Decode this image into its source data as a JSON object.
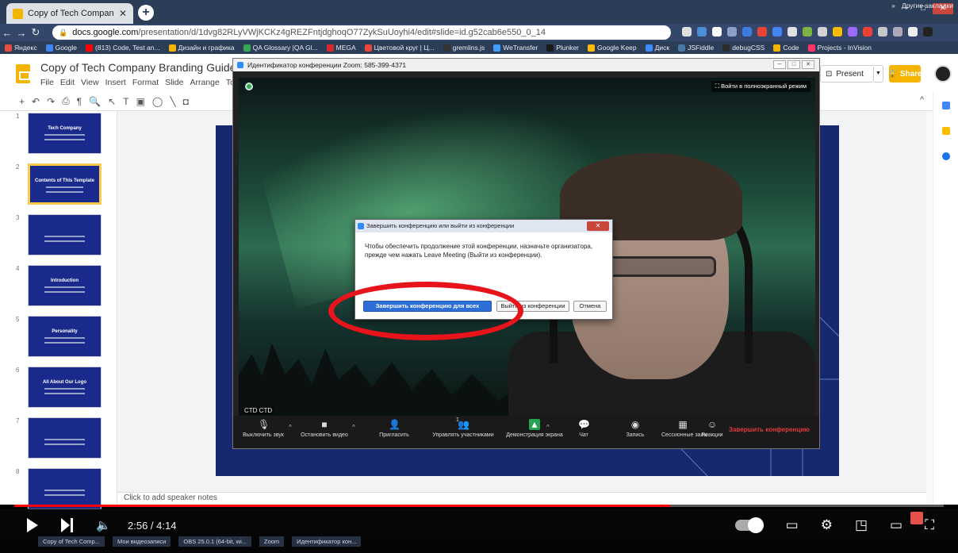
{
  "browser": {
    "tab_title": "Copy of Tech Company Branding",
    "url_host": "docs.google.com",
    "url_path": "/presentation/d/1dvg82RLyVWjKCKz4gREZFntjdghoqO77ZykSuUoyhi4/edit#slide=id.g52cab6e550_0_14",
    "bookmarks": [
      {
        "label": "Яндекс",
        "color": "#e74c3c"
      },
      {
        "label": "Google",
        "color": "#4285f4"
      },
      {
        "label": "(813) Code, Test an...",
        "color": "#ff0000"
      },
      {
        "label": "Дизайн и графика",
        "color": "#f4b400"
      },
      {
        "label": "QA Glossary |QA Gl...",
        "color": "#34a853"
      },
      {
        "label": "MEGA",
        "color": "#d9272e"
      },
      {
        "label": "Цветовой круг | Ц...",
        "color": "#e8453c"
      },
      {
        "label": "gremlins.js",
        "color": "#333333"
      },
      {
        "label": "WeTransfer",
        "color": "#409fff"
      },
      {
        "label": "Plunker",
        "color": "#1a1a1a"
      },
      {
        "label": "Google Keep",
        "color": "#fbbc04"
      },
      {
        "label": "Диск",
        "color": "#3d8bff"
      },
      {
        "label": "JSFiddle",
        "color": "#4679a4"
      },
      {
        "label": "debugCSS",
        "color": "#2b2b2b"
      },
      {
        "label": "Code",
        "color": "#f4b400"
      },
      {
        "label": "Projects - InVision",
        "color": "#ff3366"
      }
    ],
    "other_bookmarks": "Другие закладки"
  },
  "slides": {
    "doc_title": "Copy of Tech Company Branding Guidelines by",
    "menu": [
      "File",
      "Edit",
      "View",
      "Insert",
      "Format",
      "Slide",
      "Arrange",
      "Tools"
    ],
    "present_label": "Present",
    "share_label": "Share",
    "thumbnails": [
      {
        "num": "1",
        "text": "Tech Company",
        "selected": false
      },
      {
        "num": "2",
        "text": "Contents of This Template",
        "selected": true
      },
      {
        "num": "3",
        "text": "",
        "selected": false
      },
      {
        "num": "4",
        "text": "Introduction",
        "selected": false
      },
      {
        "num": "5",
        "text": "Personality",
        "selected": false
      },
      {
        "num": "6",
        "text": "All About Our Logo",
        "selected": false
      },
      {
        "num": "7",
        "text": "",
        "selected": false
      },
      {
        "num": "8",
        "text": "",
        "selected": false
      }
    ],
    "notes_placeholder": "Click to add speaker notes"
  },
  "zoom": {
    "window_title": "Идентификатор конференции Zoom: 585-399-4371",
    "fullscreen_label": "Войти в полноэкранный режим",
    "participant_name": "CTD CTD",
    "participants_count": "1",
    "toolbar": [
      {
        "label": "Выключить звук",
        "icon": "microphone-icon"
      },
      {
        "label": "Остановить видео",
        "icon": "video-camera-icon"
      },
      {
        "label": "Пригласить",
        "icon": "invite-icon"
      },
      {
        "label": "Управлять участниками",
        "icon": "participants-icon"
      },
      {
        "label": "Демонстрация экрана",
        "icon": "share-screen-icon"
      },
      {
        "label": "Чат",
        "icon": "chat-icon"
      },
      {
        "label": "Запись",
        "icon": "record-icon"
      },
      {
        "label": "Сессионные залы",
        "icon": "breakout-rooms-icon"
      },
      {
        "label": "Реакции",
        "icon": "reactions-icon"
      }
    ],
    "end_label": "Завершить конференцию",
    "dialog": {
      "title": "Завершить конференцию или выйти из конференции",
      "message": "Чтобы обеспечить продолжение этой конференции, назначьте организатора, прежде чем нажать Leave Meeting (Выйти из конференции).",
      "end_for_all": "Завершить конференцию для всех",
      "leave": "Выйти из конференции",
      "cancel": "Отмена"
    }
  },
  "player": {
    "time_current": "2:56",
    "time_total": "4:14",
    "time_display": "2:56 / 4:14",
    "progress_fraction": 0.706
  },
  "taskbar": [
    "Copy of Tech Comp...",
    "Мои видеозаписи",
    "OBS 25.0.1 (64-bit, wi...",
    "Zoom",
    "Идентификатор кон..."
  ],
  "colors": {
    "slides_accent": "#f4b400",
    "slide_bg": "#17286f",
    "zoom_blue": "#2d8cff",
    "zoom_end_red": "#e23b3b",
    "highlight_ring": "#e8141b",
    "youtube_red": "#ff0000"
  }
}
